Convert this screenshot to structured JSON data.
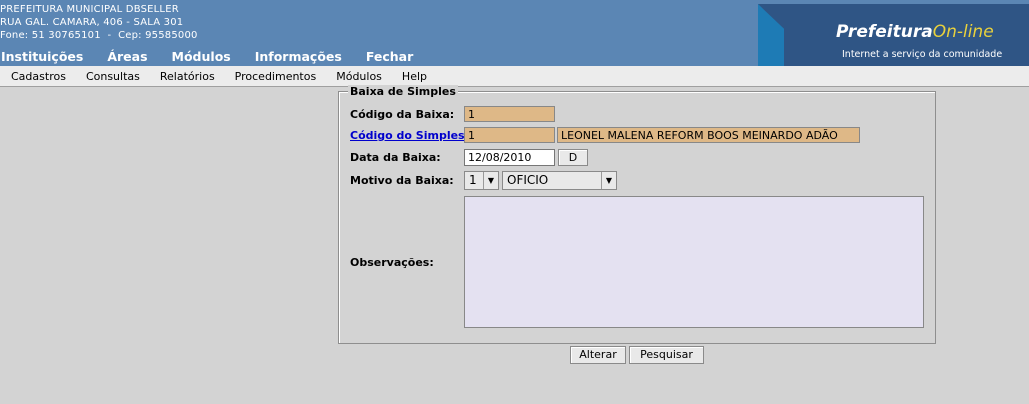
{
  "header": {
    "org_line1": "PREFEITURA MUNICIPAL DBSELLER",
    "org_line2": "RUA GAL. CAMARA, 406 - SALA 301",
    "org_line3": "Fone: 51 30765101  -  Cep: 95585000",
    "logo_main": "Prefeitura",
    "logo_accent": "On-line",
    "logo_tagline": "Internet a serviço da comunidade"
  },
  "top_menu": [
    "Instituições",
    "Áreas",
    "Módulos",
    "Informações",
    "Fechar"
  ],
  "menu_bar": [
    "Cadastros",
    "Consultas",
    "Relatórios",
    "Procedimentos",
    "Módulos",
    "Help"
  ],
  "form": {
    "legend": "Baixa de Simples",
    "codigo_baixa_label": "Código da Baixa:",
    "codigo_baixa_value": "1",
    "codigo_simples_label": "Código do Simples:",
    "codigo_simples_value": "1",
    "contribuinte_nome": "LEONEL MALENA REFORM BOOS MEINARDO ADÃO",
    "data_baixa_label": "Data da Baixa:",
    "data_baixa_value": "12/08/2010",
    "data_button": "D",
    "motivo_label": "Motivo da Baixa:",
    "motivo_code": "1",
    "motivo_text": "OFICIO",
    "observacoes_label": "Observações:",
    "alterar_button": "Alterar",
    "pesquisar_button": "Pesquisar"
  },
  "colors": {
    "header_bg": "#5b86b4",
    "readonly_bg": "#deb887",
    "textarea_bg": "#e4e1f1",
    "link": "#0000cc",
    "logo_accent": "#e9d13c"
  }
}
